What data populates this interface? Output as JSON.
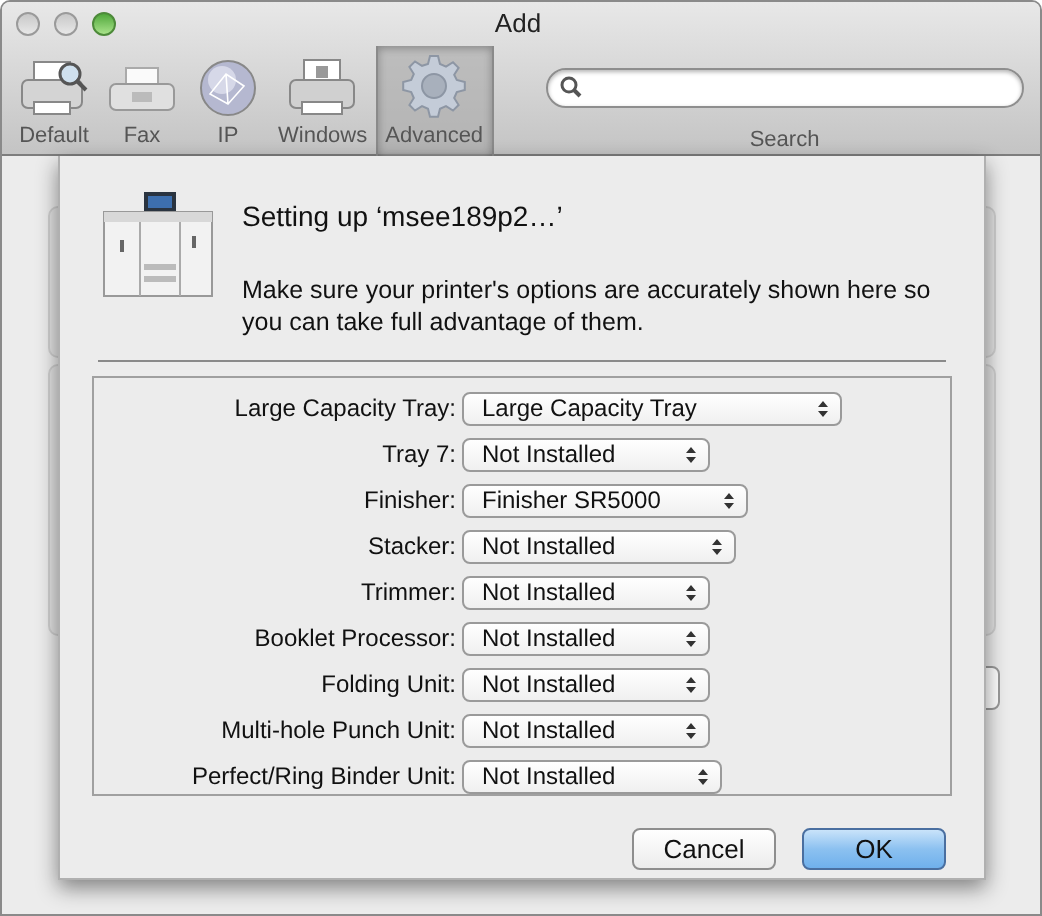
{
  "window": {
    "title": "Add"
  },
  "toolbar": {
    "items": [
      {
        "label": "Default",
        "kind": "default",
        "selected": false
      },
      {
        "label": "Fax",
        "kind": "fax",
        "selected": false
      },
      {
        "label": "IP",
        "kind": "ip",
        "selected": false
      },
      {
        "label": "Windows",
        "kind": "windows",
        "selected": false
      },
      {
        "label": "Advanced",
        "kind": "advanced",
        "selected": true
      }
    ],
    "search": {
      "label": "Search"
    }
  },
  "sheet": {
    "title": "Setting up ‘msee189p2…’",
    "message": "Make sure your printer's options are accurately shown here so you can take full advantage of them.",
    "options": [
      {
        "label": "Large Capacity Tray:",
        "value": "Large Capacity Tray"
      },
      {
        "label": "Tray 7:",
        "value": "Not Installed"
      },
      {
        "label": "Finisher:",
        "value": "Finisher SR5000"
      },
      {
        "label": "Stacker:",
        "value": "Not Installed"
      },
      {
        "label": "Trimmer:",
        "value": "Not Installed"
      },
      {
        "label": "Booklet Processor:",
        "value": "Not Installed"
      },
      {
        "label": "Folding Unit:",
        "value": "Not Installed"
      },
      {
        "label": "Multi-hole Punch Unit:",
        "value": "Not Installed"
      },
      {
        "label": "Perfect/Ring Binder Unit:",
        "value": "Not Installed"
      }
    ],
    "buttons": [
      {
        "label": "Cancel",
        "kind": "cancel"
      },
      {
        "label": "OK",
        "kind": "default"
      }
    ]
  }
}
